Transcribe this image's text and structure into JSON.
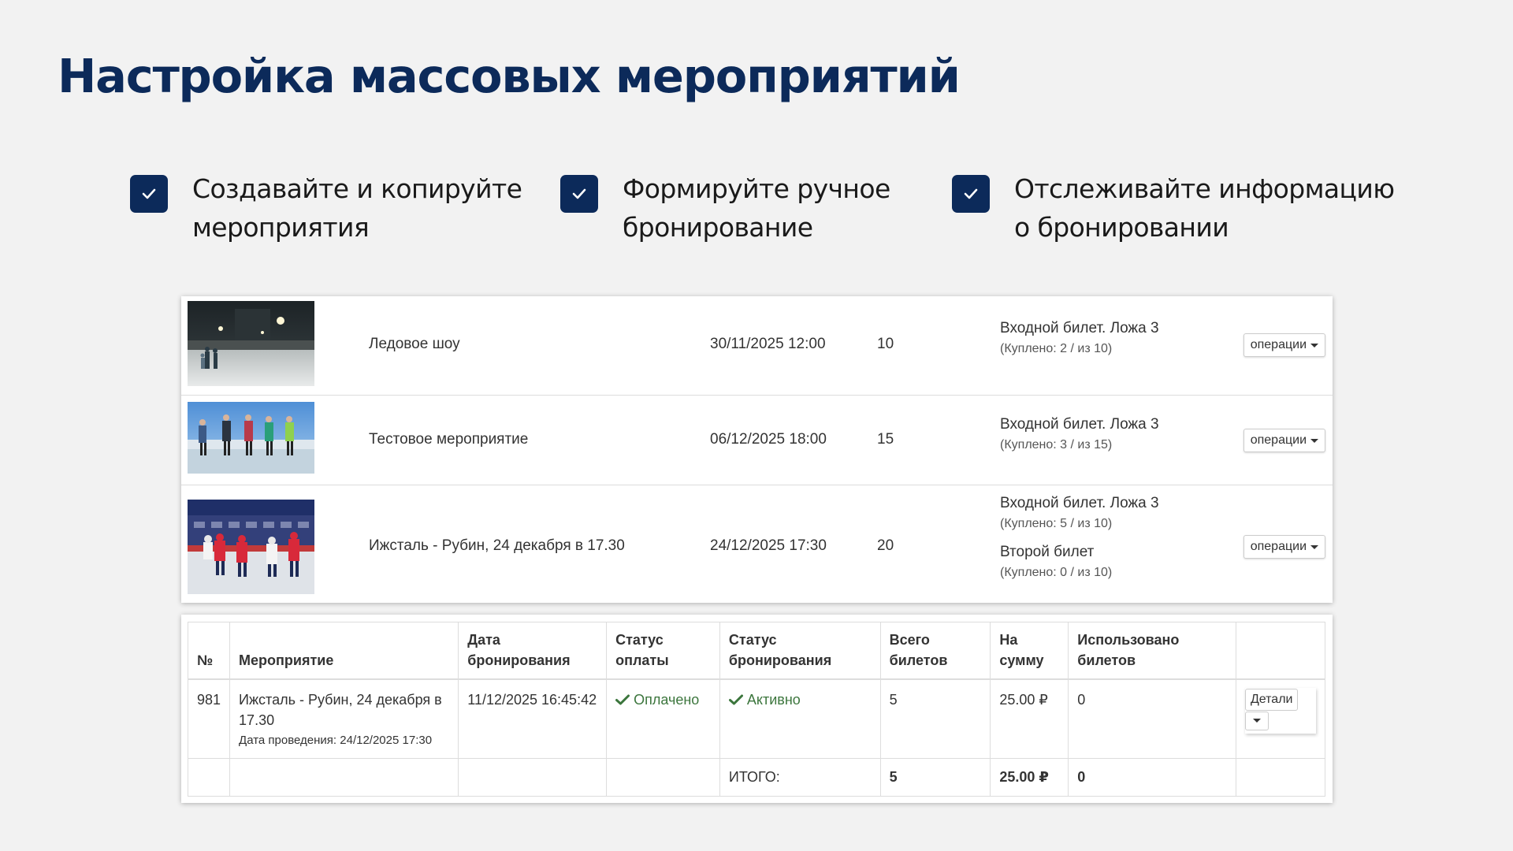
{
  "title": "Настройка массовых мероприятий",
  "features": [
    {
      "line1": "Создавайте и копируйте",
      "line2": "мероприятия"
    },
    {
      "line1": "Формируйте ручное",
      "line2": "бронирование"
    },
    {
      "line1": "Отслеживайте информацию",
      "line2": "о бронировании"
    }
  ],
  "events": [
    {
      "name": "Ледовое шоу",
      "datetime": "30/11/2025 12:00",
      "count": "10",
      "tickets": [
        {
          "name": "Входной билет. Ложа 3",
          "sold": "(Куплено: 2 / из 10)"
        }
      ],
      "ops": "операции"
    },
    {
      "name": "Тестовое мероприятие",
      "datetime": "06/12/2025 18:00",
      "count": "15",
      "tickets": [
        {
          "name": "Входной билет. Ложа 3",
          "sold": "(Куплено: 3 / из 15)"
        }
      ],
      "ops": "операции"
    },
    {
      "name": "Ижсталь - Рубин, 24 декабря в 17.30",
      "datetime": "24/12/2025 17:30",
      "count": "20",
      "tickets": [
        {
          "name": "Входной билет. Ложа 3",
          "sold": "(Куплено: 5 / из 10)"
        },
        {
          "name": "Второй билет",
          "sold": "(Куплено: 0 / из 10)"
        }
      ],
      "ops": "операции"
    }
  ],
  "booking_table": {
    "headers": {
      "num": "№",
      "event": "Мероприятие",
      "date_line1": "Дата",
      "date_line2": "бронирования",
      "pay_line1": "Статус",
      "pay_line2": "оплаты",
      "book_line1": "Статус",
      "book_line2": "бронирования",
      "total_line1": "Всего",
      "total_line2": "билетов",
      "sum_line1": "На",
      "sum_line2": "сумму",
      "used_line1": "Использовано",
      "used_line2": "билетов"
    },
    "row": {
      "num": "981",
      "event": "Ижсталь - Рубин, 24 декабря в 17.30",
      "event_date": "Дата проведения: 24/12/2025 17:30",
      "booking_date": "11/12/2025 16:45:42",
      "pay_status": "Оплачено",
      "book_status": "Активно",
      "tickets": "5",
      "sum": "25.00 ₽",
      "used": "0",
      "details": "Детали"
    },
    "totals": {
      "label": "ИТОГО:",
      "tickets": "5",
      "sum": "25.00 ₽",
      "used": "0"
    }
  },
  "colors": {
    "navy": "#0c2a5a",
    "status_green": "#3c763d",
    "background": "#f2f2f2"
  },
  "icons": {
    "feature": "check-icon",
    "status": "check-icon",
    "dropdown": "caret-down-icon"
  }
}
